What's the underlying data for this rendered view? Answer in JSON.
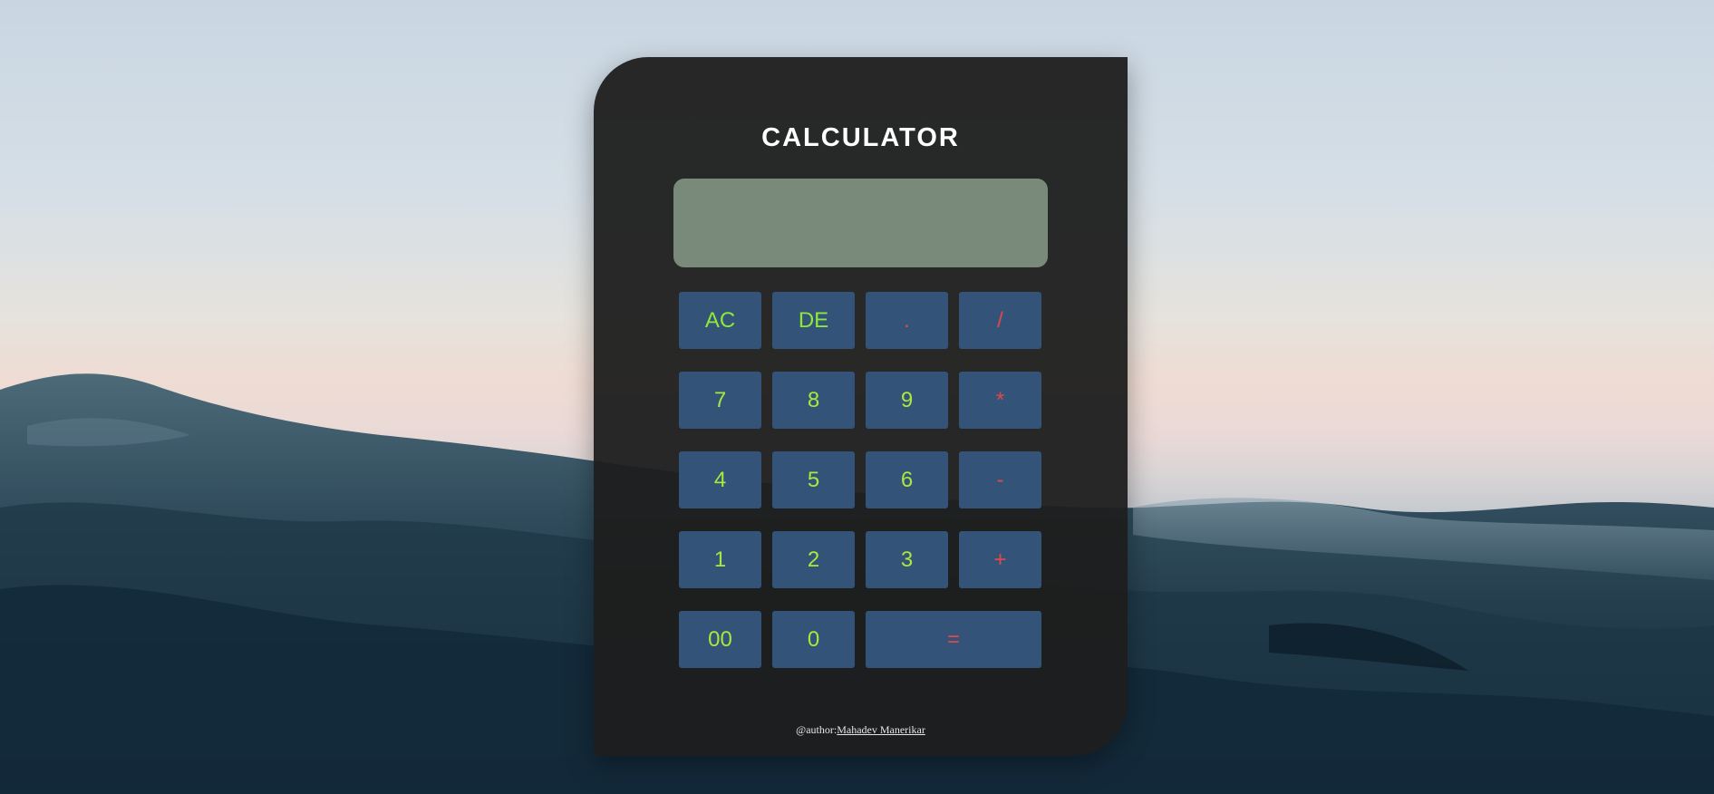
{
  "title": "CALCULATOR",
  "display": {
    "value": ""
  },
  "keys": [
    {
      "label": "AC",
      "kind": "clear"
    },
    {
      "label": "DE",
      "kind": "delete"
    },
    {
      "label": ".",
      "kind": "op"
    },
    {
      "label": "/",
      "kind": "op"
    },
    {
      "label": "7",
      "kind": "digit"
    },
    {
      "label": "8",
      "kind": "digit"
    },
    {
      "label": "9",
      "kind": "digit"
    },
    {
      "label": "*",
      "kind": "op"
    },
    {
      "label": "4",
      "kind": "digit"
    },
    {
      "label": "5",
      "kind": "digit"
    },
    {
      "label": "6",
      "kind": "digit"
    },
    {
      "label": "-",
      "kind": "op"
    },
    {
      "label": "1",
      "kind": "digit"
    },
    {
      "label": "2",
      "kind": "digit"
    },
    {
      "label": "3",
      "kind": "digit"
    },
    {
      "label": "+",
      "kind": "op"
    },
    {
      "label": "00",
      "kind": "digit"
    },
    {
      "label": "0",
      "kind": "digit"
    },
    {
      "label": "=",
      "kind": "equals"
    }
  ],
  "footer": {
    "prefix": "@author:",
    "author": "Mahadev Manerikar"
  },
  "colors": {
    "panel": "#1e1e1e",
    "display": "#7a8a7a",
    "key": "#335478",
    "digit_text": "#a9e83c",
    "op_text": "#e0474c"
  }
}
